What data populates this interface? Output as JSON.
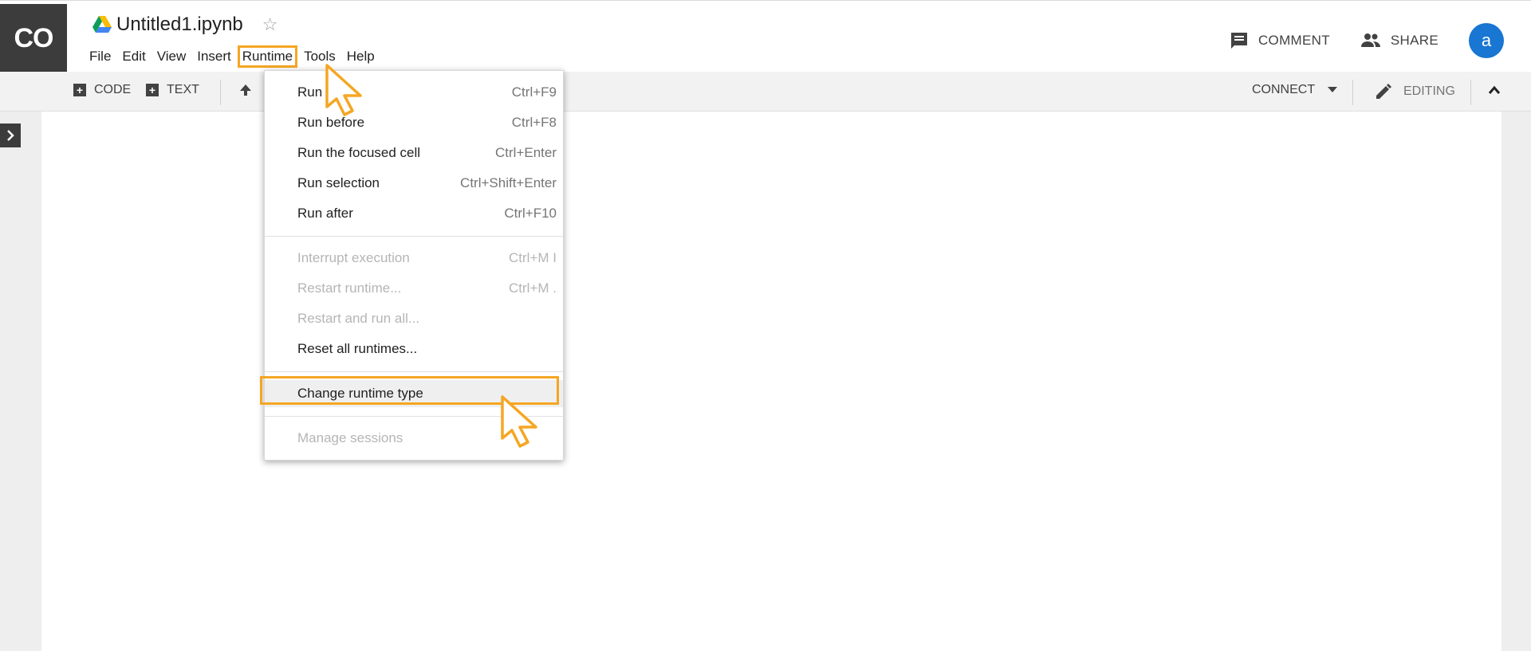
{
  "app": {
    "logo": "CO",
    "file_title": "Untitled1.ipynb"
  },
  "menubar": [
    "File",
    "Edit",
    "View",
    "Insert",
    "Runtime",
    "Tools",
    "Help"
  ],
  "header_actions": {
    "comment": "COMMENT",
    "share": "SHARE",
    "avatar": "a"
  },
  "toolbar": {
    "code": "CODE",
    "text": "TEXT",
    "connect": "CONNECT",
    "editing": "EDITING"
  },
  "runtime_menu": {
    "items": [
      {
        "label": "Run",
        "shortcut": "Ctrl+F9",
        "disabled": false
      },
      {
        "label": "Run before",
        "shortcut": "Ctrl+F8",
        "disabled": false
      },
      {
        "label": "Run the focused cell",
        "shortcut": "Ctrl+Enter",
        "disabled": false
      },
      {
        "label": "Run selection",
        "shortcut": "Ctrl+Shift+Enter",
        "disabled": false
      },
      {
        "label": "Run after",
        "shortcut": "Ctrl+F10",
        "disabled": false
      },
      {
        "label": "Interrupt execution",
        "shortcut": "Ctrl+M I",
        "disabled": true
      },
      {
        "label": "Restart runtime...",
        "shortcut": "Ctrl+M .",
        "disabled": true
      },
      {
        "label": "Restart and run all...",
        "shortcut": "",
        "disabled": true
      },
      {
        "label": "Reset all runtimes...",
        "shortcut": "",
        "disabled": false
      },
      {
        "label": "Change runtime type",
        "shortcut": "",
        "disabled": false,
        "highlighted": true
      },
      {
        "label": "Manage sessions",
        "shortcut": "",
        "disabled": true
      }
    ]
  },
  "colors": {
    "highlight": "#f5a623",
    "avatar": "#1976d2",
    "logo_bg": "#3c3c3c"
  },
  "icons": [
    "drive-icon",
    "star-icon",
    "comment-icon",
    "share-icon",
    "pencil-icon",
    "caret-down-icon",
    "chevron-up-icon",
    "chevron-right-icon",
    "arrow-up-icon",
    "cursor-icon"
  ]
}
